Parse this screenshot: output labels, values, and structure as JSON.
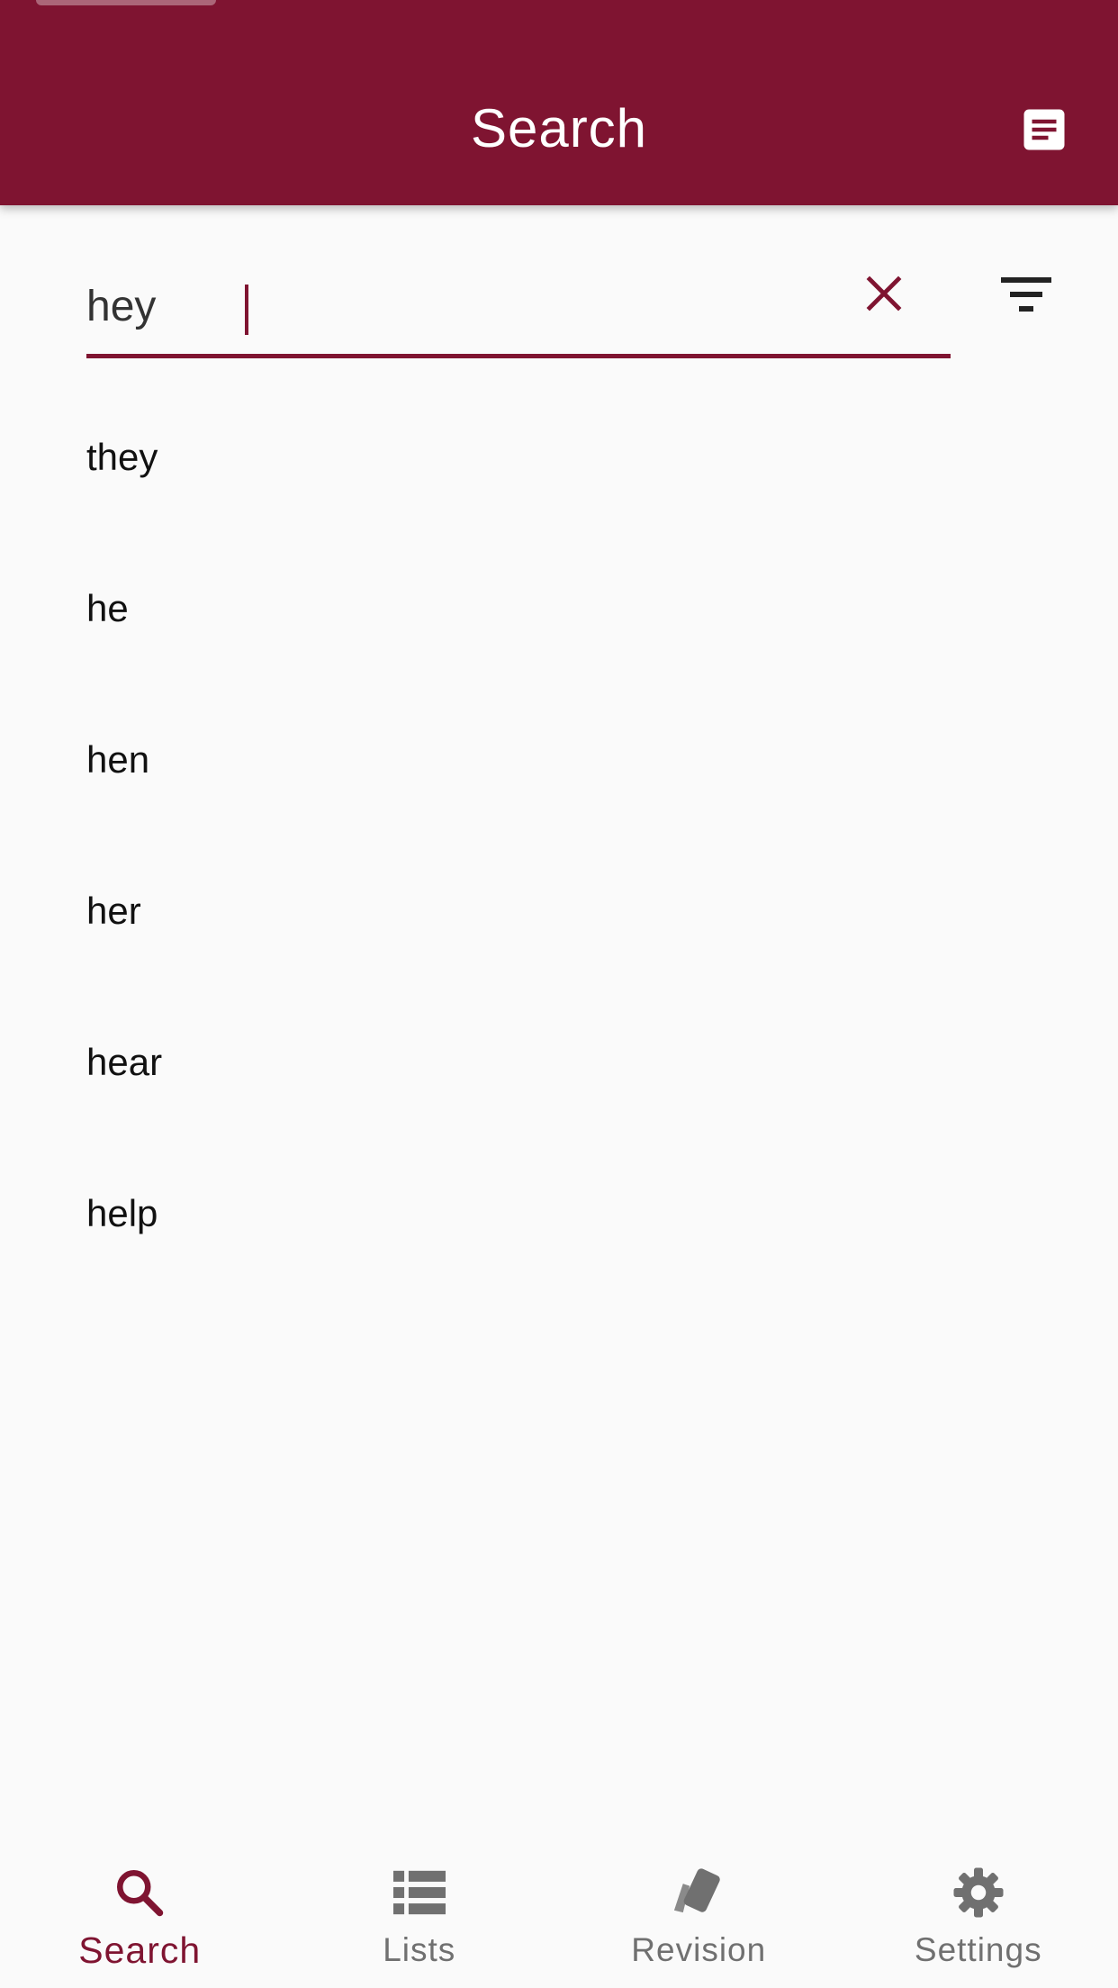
{
  "app": {
    "title": "Search",
    "accent_color": "#7f1431",
    "header_action_icon": "notes-icon"
  },
  "search": {
    "value": "hey",
    "clear_icon": "close-icon",
    "filter_icon": "filter-icon"
  },
  "results": [
    "they",
    "he",
    "hen",
    "her",
    "hear",
    "help"
  ],
  "bottom_nav": {
    "active": "Search",
    "items": [
      {
        "label": "Search",
        "icon": "search-icon"
      },
      {
        "label": "Lists",
        "icon": "list-icon"
      },
      {
        "label": "Revision",
        "icon": "cards-icon"
      },
      {
        "label": "Settings",
        "icon": "gear-icon"
      }
    ]
  }
}
